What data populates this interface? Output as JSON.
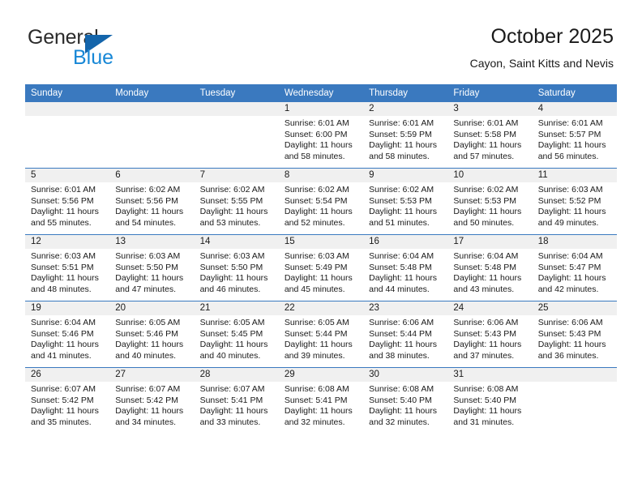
{
  "brand": {
    "name_part1": "General",
    "name_part2": "Blue",
    "triangle_color": "#1465ab",
    "blue_color": "#1787d6"
  },
  "header": {
    "title": "October 2025",
    "subtitle": "Cayon, Saint Kitts and Nevis"
  },
  "theme": {
    "header_row_bg": "#3a79bf",
    "daynum_band_bg": "#f0f0f0",
    "grid_line": "#3a79bf"
  },
  "weekday_headers": [
    "Sunday",
    "Monday",
    "Tuesday",
    "Wednesday",
    "Thursday",
    "Friday",
    "Saturday"
  ],
  "weeks": [
    [
      {
        "day": "",
        "sunrise": "",
        "sunset": "",
        "daylight_line1": "",
        "daylight_line2": "",
        "empty": true
      },
      {
        "day": "",
        "sunrise": "",
        "sunset": "",
        "daylight_line1": "",
        "daylight_line2": "",
        "empty": true
      },
      {
        "day": "",
        "sunrise": "",
        "sunset": "",
        "daylight_line1": "",
        "daylight_line2": "",
        "empty": true
      },
      {
        "day": "1",
        "sunrise": "Sunrise: 6:01 AM",
        "sunset": "Sunset: 6:00 PM",
        "daylight_line1": "Daylight: 11 hours",
        "daylight_line2": "and 58 minutes."
      },
      {
        "day": "2",
        "sunrise": "Sunrise: 6:01 AM",
        "sunset": "Sunset: 5:59 PM",
        "daylight_line1": "Daylight: 11 hours",
        "daylight_line2": "and 58 minutes."
      },
      {
        "day": "3",
        "sunrise": "Sunrise: 6:01 AM",
        "sunset": "Sunset: 5:58 PM",
        "daylight_line1": "Daylight: 11 hours",
        "daylight_line2": "and 57 minutes."
      },
      {
        "day": "4",
        "sunrise": "Sunrise: 6:01 AM",
        "sunset": "Sunset: 5:57 PM",
        "daylight_line1": "Daylight: 11 hours",
        "daylight_line2": "and 56 minutes."
      }
    ],
    [
      {
        "day": "5",
        "sunrise": "Sunrise: 6:01 AM",
        "sunset": "Sunset: 5:56 PM",
        "daylight_line1": "Daylight: 11 hours",
        "daylight_line2": "and 55 minutes."
      },
      {
        "day": "6",
        "sunrise": "Sunrise: 6:02 AM",
        "sunset": "Sunset: 5:56 PM",
        "daylight_line1": "Daylight: 11 hours",
        "daylight_line2": "and 54 minutes."
      },
      {
        "day": "7",
        "sunrise": "Sunrise: 6:02 AM",
        "sunset": "Sunset: 5:55 PM",
        "daylight_line1": "Daylight: 11 hours",
        "daylight_line2": "and 53 minutes."
      },
      {
        "day": "8",
        "sunrise": "Sunrise: 6:02 AM",
        "sunset": "Sunset: 5:54 PM",
        "daylight_line1": "Daylight: 11 hours",
        "daylight_line2": "and 52 minutes."
      },
      {
        "day": "9",
        "sunrise": "Sunrise: 6:02 AM",
        "sunset": "Sunset: 5:53 PM",
        "daylight_line1": "Daylight: 11 hours",
        "daylight_line2": "and 51 minutes."
      },
      {
        "day": "10",
        "sunrise": "Sunrise: 6:02 AM",
        "sunset": "Sunset: 5:53 PM",
        "daylight_line1": "Daylight: 11 hours",
        "daylight_line2": "and 50 minutes."
      },
      {
        "day": "11",
        "sunrise": "Sunrise: 6:03 AM",
        "sunset": "Sunset: 5:52 PM",
        "daylight_line1": "Daylight: 11 hours",
        "daylight_line2": "and 49 minutes."
      }
    ],
    [
      {
        "day": "12",
        "sunrise": "Sunrise: 6:03 AM",
        "sunset": "Sunset: 5:51 PM",
        "daylight_line1": "Daylight: 11 hours",
        "daylight_line2": "and 48 minutes."
      },
      {
        "day": "13",
        "sunrise": "Sunrise: 6:03 AM",
        "sunset": "Sunset: 5:50 PM",
        "daylight_line1": "Daylight: 11 hours",
        "daylight_line2": "and 47 minutes."
      },
      {
        "day": "14",
        "sunrise": "Sunrise: 6:03 AM",
        "sunset": "Sunset: 5:50 PM",
        "daylight_line1": "Daylight: 11 hours",
        "daylight_line2": "and 46 minutes."
      },
      {
        "day": "15",
        "sunrise": "Sunrise: 6:03 AM",
        "sunset": "Sunset: 5:49 PM",
        "daylight_line1": "Daylight: 11 hours",
        "daylight_line2": "and 45 minutes."
      },
      {
        "day": "16",
        "sunrise": "Sunrise: 6:04 AM",
        "sunset": "Sunset: 5:48 PM",
        "daylight_line1": "Daylight: 11 hours",
        "daylight_line2": "and 44 minutes."
      },
      {
        "day": "17",
        "sunrise": "Sunrise: 6:04 AM",
        "sunset": "Sunset: 5:48 PM",
        "daylight_line1": "Daylight: 11 hours",
        "daylight_line2": "and 43 minutes."
      },
      {
        "day": "18",
        "sunrise": "Sunrise: 6:04 AM",
        "sunset": "Sunset: 5:47 PM",
        "daylight_line1": "Daylight: 11 hours",
        "daylight_line2": "and 42 minutes."
      }
    ],
    [
      {
        "day": "19",
        "sunrise": "Sunrise: 6:04 AM",
        "sunset": "Sunset: 5:46 PM",
        "daylight_line1": "Daylight: 11 hours",
        "daylight_line2": "and 41 minutes."
      },
      {
        "day": "20",
        "sunrise": "Sunrise: 6:05 AM",
        "sunset": "Sunset: 5:46 PM",
        "daylight_line1": "Daylight: 11 hours",
        "daylight_line2": "and 40 minutes."
      },
      {
        "day": "21",
        "sunrise": "Sunrise: 6:05 AM",
        "sunset": "Sunset: 5:45 PM",
        "daylight_line1": "Daylight: 11 hours",
        "daylight_line2": "and 40 minutes."
      },
      {
        "day": "22",
        "sunrise": "Sunrise: 6:05 AM",
        "sunset": "Sunset: 5:44 PM",
        "daylight_line1": "Daylight: 11 hours",
        "daylight_line2": "and 39 minutes."
      },
      {
        "day": "23",
        "sunrise": "Sunrise: 6:06 AM",
        "sunset": "Sunset: 5:44 PM",
        "daylight_line1": "Daylight: 11 hours",
        "daylight_line2": "and 38 minutes."
      },
      {
        "day": "24",
        "sunrise": "Sunrise: 6:06 AM",
        "sunset": "Sunset: 5:43 PM",
        "daylight_line1": "Daylight: 11 hours",
        "daylight_line2": "and 37 minutes."
      },
      {
        "day": "25",
        "sunrise": "Sunrise: 6:06 AM",
        "sunset": "Sunset: 5:43 PM",
        "daylight_line1": "Daylight: 11 hours",
        "daylight_line2": "and 36 minutes."
      }
    ],
    [
      {
        "day": "26",
        "sunrise": "Sunrise: 6:07 AM",
        "sunset": "Sunset: 5:42 PM",
        "daylight_line1": "Daylight: 11 hours",
        "daylight_line2": "and 35 minutes."
      },
      {
        "day": "27",
        "sunrise": "Sunrise: 6:07 AM",
        "sunset": "Sunset: 5:42 PM",
        "daylight_line1": "Daylight: 11 hours",
        "daylight_line2": "and 34 minutes."
      },
      {
        "day": "28",
        "sunrise": "Sunrise: 6:07 AM",
        "sunset": "Sunset: 5:41 PM",
        "daylight_line1": "Daylight: 11 hours",
        "daylight_line2": "and 33 minutes."
      },
      {
        "day": "29",
        "sunrise": "Sunrise: 6:08 AM",
        "sunset": "Sunset: 5:41 PM",
        "daylight_line1": "Daylight: 11 hours",
        "daylight_line2": "and 32 minutes."
      },
      {
        "day": "30",
        "sunrise": "Sunrise: 6:08 AM",
        "sunset": "Sunset: 5:40 PM",
        "daylight_line1": "Daylight: 11 hours",
        "daylight_line2": "and 32 minutes."
      },
      {
        "day": "31",
        "sunrise": "Sunrise: 6:08 AM",
        "sunset": "Sunset: 5:40 PM",
        "daylight_line1": "Daylight: 11 hours",
        "daylight_line2": "and 31 minutes."
      },
      {
        "day": "",
        "sunrise": "",
        "sunset": "",
        "daylight_line1": "",
        "daylight_line2": "",
        "empty": true
      }
    ]
  ]
}
